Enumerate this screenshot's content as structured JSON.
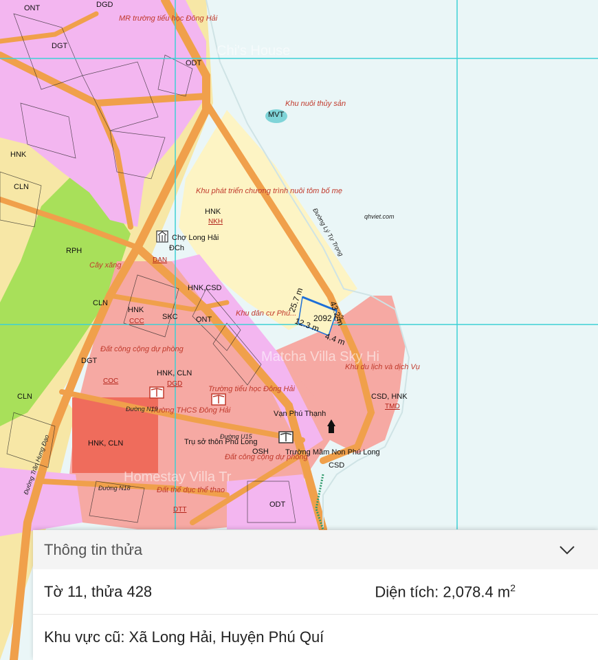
{
  "map": {
    "plot_labels": [
      {
        "id": "ont1",
        "text": "ONT"
      },
      {
        "id": "cln1",
        "text": "CLN"
      },
      {
        "id": "dgd1",
        "text": "DGD"
      },
      {
        "id": "hnk1",
        "text": "HNK"
      },
      {
        "id": "dgt1",
        "text": "DGT"
      },
      {
        "id": "odt1",
        "text": "ODT"
      },
      {
        "id": "rph",
        "text": "RPH"
      },
      {
        "id": "hnk_nkh",
        "text": "HNK"
      },
      {
        "id": "nkh",
        "text": "NKH"
      },
      {
        "id": "mvt",
        "text": "MVT"
      },
      {
        "id": "hnk_csd",
        "text": "HNK,CSD"
      },
      {
        "id": "skc",
        "text": "SKC"
      },
      {
        "id": "ccc",
        "text": "CCC"
      },
      {
        "id": "coc",
        "text": "COC"
      },
      {
        "id": "hnk_cln",
        "text": "HNK, CLN"
      },
      {
        "id": "dgd2",
        "text": "DGD"
      },
      {
        "id": "dgt2",
        "text": "DGT"
      },
      {
        "id": "csd_hnk",
        "text": "CSD, HNK"
      },
      {
        "id": "tmd",
        "text": "TMD"
      },
      {
        "id": "osh",
        "text": "OSH"
      },
      {
        "id": "csd",
        "text": "CSD"
      },
      {
        "id": "dtt",
        "text": "DTT"
      },
      {
        "id": "hnk_cln2",
        "text": "HNK, CLN"
      },
      {
        "id": "dan",
        "text": "DAN"
      },
      {
        "id": "cln2",
        "text": "CLN"
      },
      {
        "id": "hnk2",
        "text": "HNK"
      },
      {
        "id": "ont2",
        "text": "ONT"
      },
      {
        "id": "dct",
        "text": "ĐCh"
      },
      {
        "id": "odt2",
        "text": "ODT"
      },
      {
        "id": "cln3",
        "text": "CLN"
      }
    ],
    "place_labels": [
      {
        "id": "mr_school",
        "text": "MR trường tiểu học Đông Hải"
      },
      {
        "id": "aqua",
        "text": "Khu nuôi thủy sản"
      },
      {
        "id": "shrimp",
        "text": "Khu phát triển chương trình nuôi tôm bố mẹ"
      },
      {
        "id": "market",
        "text": "Chợ Long Hải"
      },
      {
        "id": "gas",
        "text": "Cây xăng"
      },
      {
        "id": "residential",
        "text": "Khu dân cư Phú..."
      },
      {
        "id": "public_phong",
        "text": "Đất công cộng dự phòng"
      },
      {
        "id": "tourism",
        "text": "Khu du lịch và dịch Vụ"
      },
      {
        "id": "primary",
        "text": "Trường tiểu học Đông Hải"
      },
      {
        "id": "thcs",
        "text": "Trường THCS Đông Hải"
      },
      {
        "id": "van",
        "text": "Vạn Phú Thạnh"
      },
      {
        "id": "village_hq",
        "text": "Trụ sở thôn Phú Long"
      },
      {
        "id": "public_land",
        "text": "Đất công cộng dự phòng"
      },
      {
        "id": "kindergarten",
        "text": "Trường Mầm Non Phú Long"
      },
      {
        "id": "sports",
        "text": "Đất thể dục thể thao"
      },
      {
        "id": "ly_tu_trong",
        "text": "Đường Lý Tự Trọng"
      },
      {
        "id": "tran_hung_dao",
        "text": "Đường Trần Hưng Đạo"
      },
      {
        "id": "n19",
        "text": "Đường N19"
      },
      {
        "id": "n18",
        "text": "Đường N18"
      },
      {
        "id": "u15",
        "text": "Đường U15"
      },
      {
        "id": "watermark",
        "text": "qhviet.com"
      },
      {
        "id": "ghost1",
        "text": "Chi's House"
      },
      {
        "id": "ghost2",
        "text": "Matcha Villa Sky Hi"
      },
      {
        "id": "ghost3",
        "text": "Homestay Villa Tr"
      }
    ],
    "measurements": {
      "edge_top": "25.7 m",
      "edge_right": "43.2 m",
      "edge_bottom": "12.3 m",
      "edge_bottom2": "4.4 m",
      "area": "2092 m²"
    },
    "colors": {
      "sea": "#eaf6f7",
      "residential": "#f3b6f0",
      "public": "#f6a9a3",
      "agri": "#f7e7a6",
      "forest": "#a8e05a",
      "road": "#f0a04b",
      "grid": "#3cd0d6",
      "highlight": "#ef6c5c"
    }
  },
  "panel": {
    "title": "Thông tin thửa",
    "parcel": "Tờ 11, thửa 428",
    "area_label": "Diện tích: 2,078.4 m",
    "area_sup": "2",
    "old_area": "Khu vực cũ: Xã Long Hải, Huyện Phú Quí"
  }
}
